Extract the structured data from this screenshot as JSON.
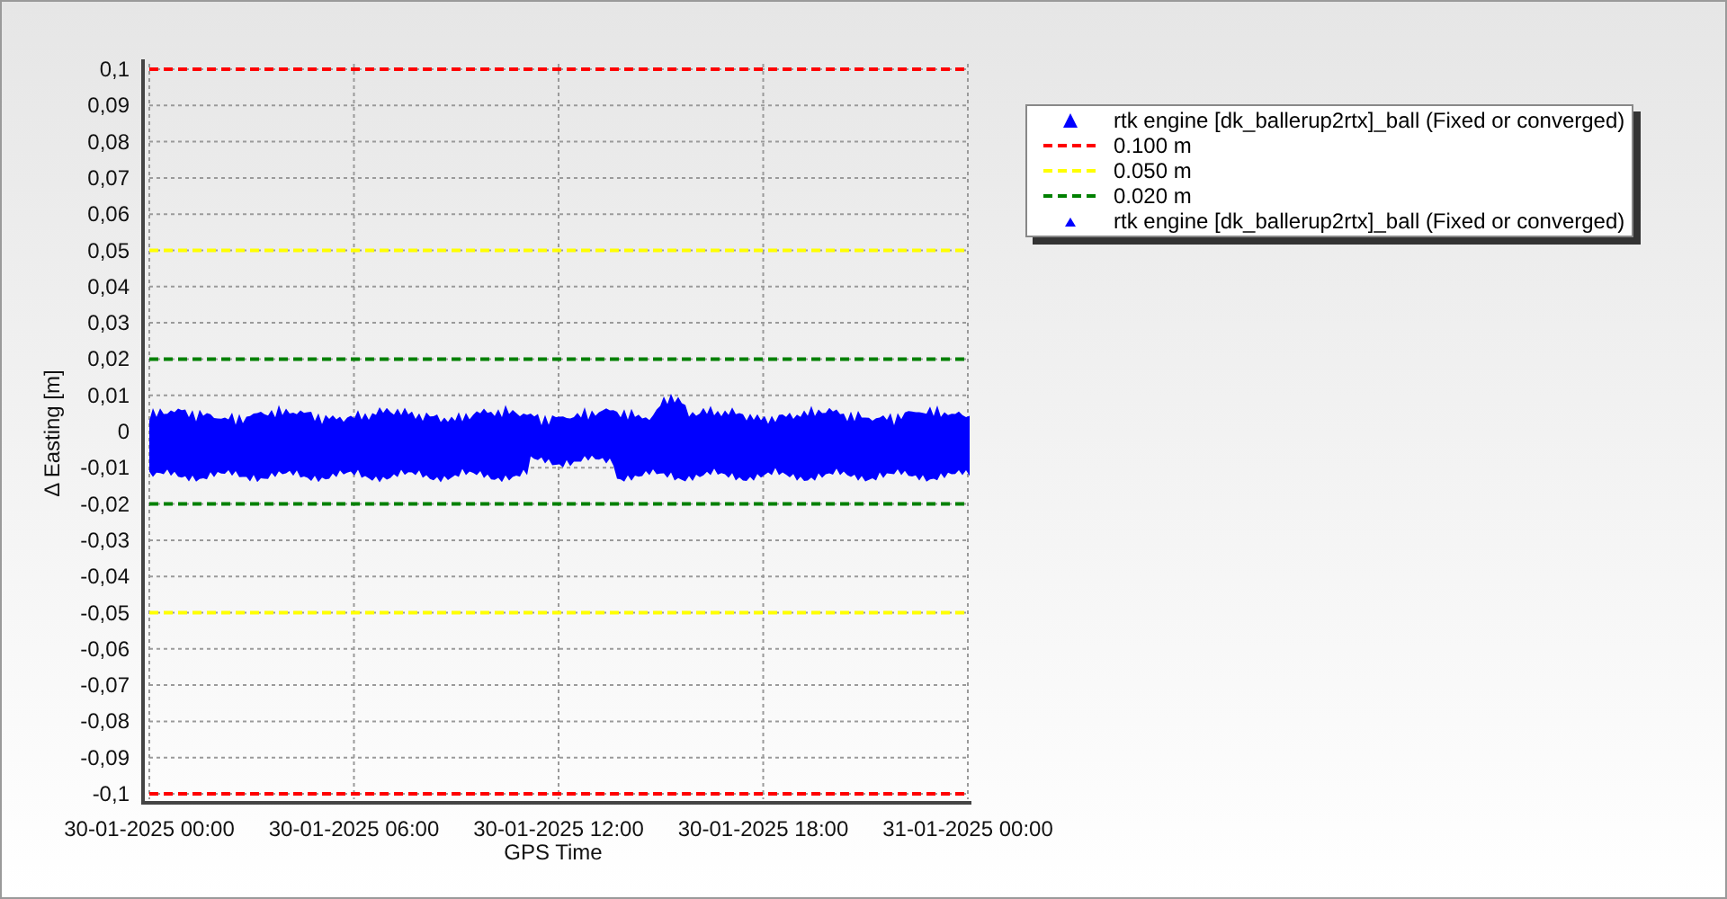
{
  "chart_data": {
    "type": "line",
    "xlabel": "GPS Time",
    "ylabel": "Δ Easting [m]",
    "categories": [
      "30-01-2025 00:00",
      "30-01-2025 06:00",
      "30-01-2025 12:00",
      "30-01-2025 18:00",
      "31-01-2025 00:00"
    ],
    "ylim": [
      -0.1,
      0.1
    ],
    "yticks": [
      {
        "value": 0.1,
        "label": "0,1"
      },
      {
        "value": 0.09,
        "label": "0,09"
      },
      {
        "value": 0.08,
        "label": "0,08"
      },
      {
        "value": 0.07,
        "label": "0,07"
      },
      {
        "value": 0.06,
        "label": "0,06"
      },
      {
        "value": 0.05,
        "label": "0,05"
      },
      {
        "value": 0.04,
        "label": "0,04"
      },
      {
        "value": 0.03,
        "label": "0,03"
      },
      {
        "value": 0.02,
        "label": "0,02"
      },
      {
        "value": 0.01,
        "label": "0,01"
      },
      {
        "value": 0,
        "label": "0"
      },
      {
        "value": -0.01,
        "label": "-0,01"
      },
      {
        "value": -0.02,
        "label": "-0,02"
      },
      {
        "value": -0.03,
        "label": "-0,03"
      },
      {
        "value": -0.04,
        "label": "-0,04"
      },
      {
        "value": -0.05,
        "label": "-0,05"
      },
      {
        "value": -0.06,
        "label": "-0,06"
      },
      {
        "value": -0.07,
        "label": "-0,07"
      },
      {
        "value": -0.08,
        "label": "-0,08"
      },
      {
        "value": -0.09,
        "label": "-0,09"
      },
      {
        "value": -0.1,
        "label": "-0,1"
      }
    ],
    "grid": true,
    "series": [
      {
        "name": "0.100 m",
        "color": "#ff0000",
        "line_style": "dashed",
        "values": [
          0.1,
          0.1,
          0.1,
          0.1,
          0.1
        ]
      },
      {
        "name": "0.050 m",
        "color": "#ffff00",
        "line_style": "dashed",
        "values": [
          0.05,
          0.05,
          0.05,
          0.05,
          0.05
        ]
      },
      {
        "name": "0.020 m",
        "color": "#008000",
        "line_style": "dashed",
        "values": [
          0.02,
          0.02,
          0.02,
          0.02,
          0.02
        ]
      }
    ],
    "ref_lines": [
      {
        "axis": "y",
        "value": -0.1,
        "color": "#ff0000",
        "line_style": "dashed"
      },
      {
        "axis": "y",
        "value": -0.05,
        "color": "#ffff00",
        "line_style": "dashed"
      },
      {
        "axis": "y",
        "value": -0.02,
        "color": "#008000",
        "line_style": "dashed"
      }
    ]
  },
  "legend": [
    {
      "kind": "marker-large",
      "label": "rtk engine [dk_ballerup2rtx]_ball (Fixed or converged)",
      "color": "#0000ff"
    },
    {
      "kind": "marker-small",
      "label": "rtk engine [dk_ballerup2rtx]_ball (Fixed or converged)",
      "color": "#0000ff"
    }
  ]
}
